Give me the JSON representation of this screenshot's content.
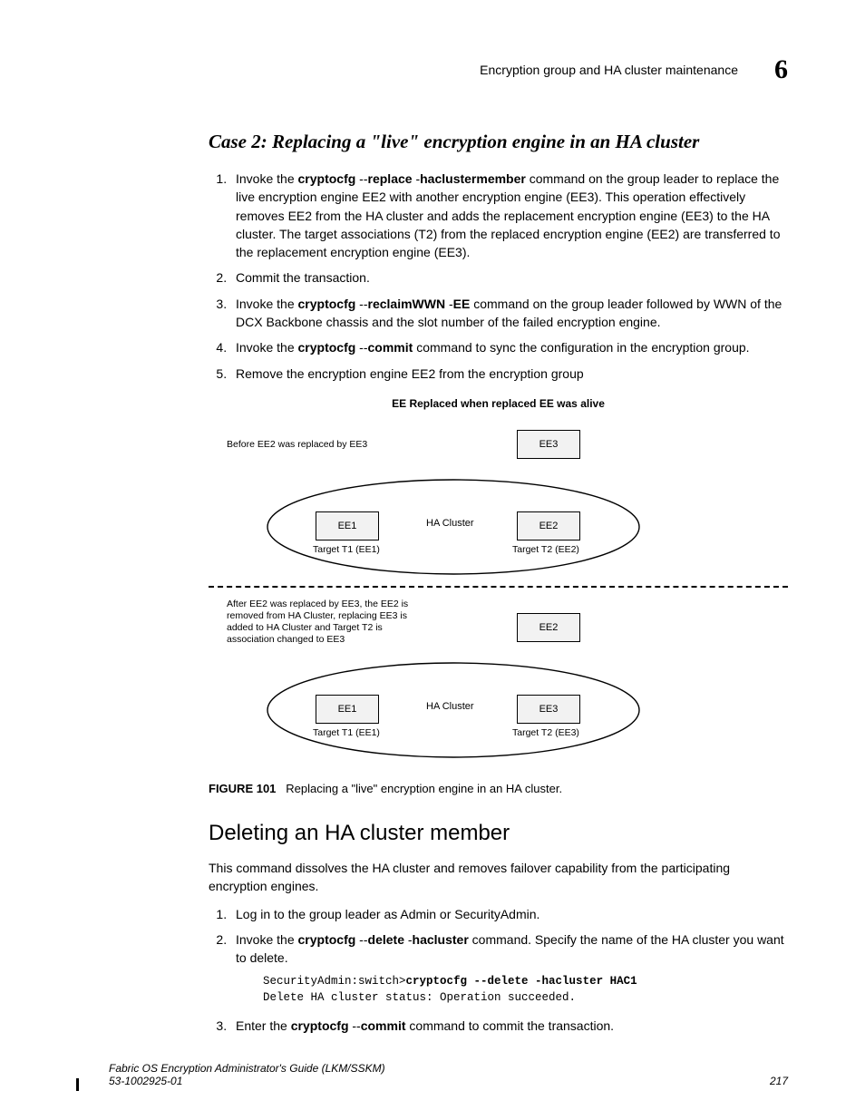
{
  "header": {
    "running_title": "Encryption group and HA cluster maintenance",
    "chapter_number": "6"
  },
  "case2": {
    "title": "Case 2: Replacing a \"live\" encryption engine in an HA cluster",
    "steps": [
      {
        "pre": "Invoke the ",
        "cmd1": "cryptocfg",
        "opt1": " --",
        "cmd2": "replace",
        "opt2": "  -",
        "cmd3": "haclustermember",
        "post": " command on the group leader to replace the live encryption engine EE2 with another encryption engine (EE3). This operation effectively removes EE2 from the HA cluster and adds the replacement encryption engine (EE3) to the HA cluster. The target associations (T2) from the replaced encryption engine (EE2) are transferred to the replacement encryption engine (EE3)."
      },
      {
        "plain": "Commit the transaction."
      },
      {
        "pre": "Invoke the ",
        "cmd1": "cryptocfg",
        "opt1": " --",
        "cmd2": "reclaimWWN",
        "opt2": "  -",
        "cmd3": "EE",
        "post": " command on the group leader followed by WWN of the DCX Backbone chassis and the slot number of the failed encryption engine."
      },
      {
        "pre": "Invoke the ",
        "cmd1": "cryptocfg",
        "opt1": " --",
        "cmd2": "commit",
        "post": " command to sync the configuration in the encryption group."
      },
      {
        "plain": "Remove the encryption engine EE2 from the encryption group"
      }
    ]
  },
  "figure": {
    "title": "EE Replaced when replaced EE was alive",
    "before_label": "Before EE2 was replaced by EE3",
    "after_label": "After EE2 was replaced by EE3, the EE2 is removed from HA Cluster, replacing EE3 is added to HA Cluster and Target T2 is association changed to EE3",
    "ha_label": "HA Cluster",
    "ee1": "EE1",
    "ee2": "EE2",
    "ee3": "EE3",
    "t1_ee1": "Target T1 (EE1)",
    "t2_ee2": "Target T2 (EE2)",
    "t2_ee3": "Target T2 (EE3)",
    "caption_num": "FIGURE 101",
    "caption_text": "Replacing a \"live\" encryption engine in an HA cluster."
  },
  "delete_section": {
    "title": "Deleting an HA cluster member",
    "intro": "This command dissolves the HA cluster and removes failover capability from the participating encryption engines.",
    "steps": [
      {
        "plain": "Log in to the group leader as Admin or SecurityAdmin."
      },
      {
        "pre": "Invoke the ",
        "cmd1": "cryptocfg",
        "opt1": " --",
        "cmd2": "delete",
        "opt2": "  -",
        "cmd3": "hacluster",
        "post": " command. Specify the name of the HA cluster you want to delete."
      },
      {
        "pre": "Enter the ",
        "cmd1": "cryptocfg",
        "opt1": " --",
        "cmd2": "commit",
        "post": " command to commit the transaction."
      }
    ],
    "code_prompt": "SecurityAdmin:switch>",
    "code_cmd": "cryptocfg --delete -hacluster HAC1",
    "code_out": "Delete HA cluster status: Operation succeeded."
  },
  "footer": {
    "title_line": "Fabric OS Encryption Administrator's Guide  (LKM/SSKM)",
    "docnum": "53-1002925-01",
    "page": "217"
  }
}
